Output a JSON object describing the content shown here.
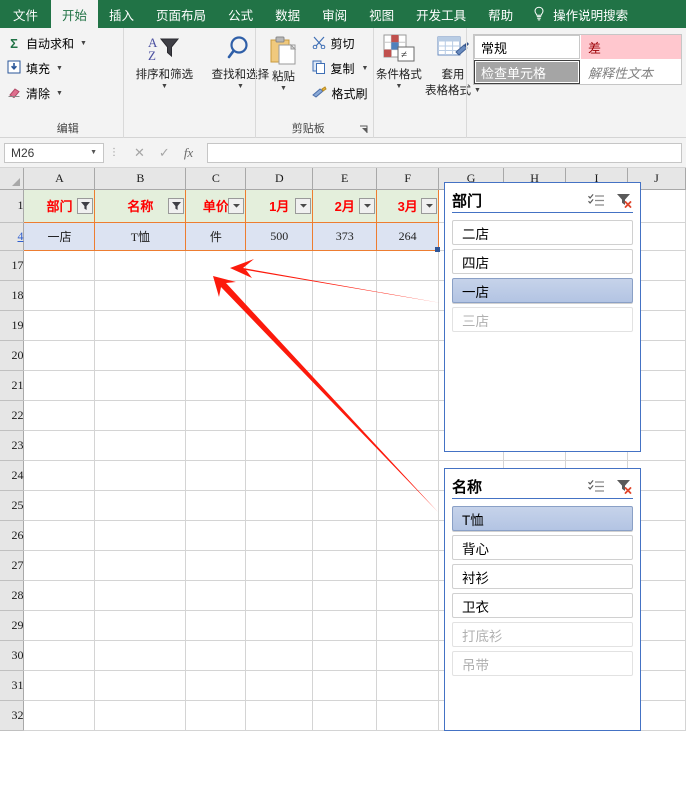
{
  "ribbon": {
    "tabs": [
      {
        "label": "文件",
        "active": false,
        "file": true
      },
      {
        "label": "开始",
        "active": true
      },
      {
        "label": "插入",
        "active": false
      },
      {
        "label": "页面布局",
        "active": false
      },
      {
        "label": "公式",
        "active": false
      },
      {
        "label": "数据",
        "active": false
      },
      {
        "label": "审阅",
        "active": false
      },
      {
        "label": "视图",
        "active": false
      },
      {
        "label": "开发工具",
        "active": false
      },
      {
        "label": "帮助",
        "active": false
      }
    ],
    "tellme": "操作说明搜索",
    "bulb_icon": "lightbulb-icon",
    "groups": {
      "editing": {
        "label": "编辑",
        "autosum": "自动求和",
        "fill": "填充",
        "clear": "清除",
        "sort_filter": "排序和筛选",
        "find_select": "查找和选择"
      },
      "clipboard": {
        "label": "剪贴板",
        "paste": "粘贴",
        "cut": "剪切",
        "copy": "复制",
        "format_painter": "格式刷",
        "dialog_launcher": "⌐"
      },
      "styles": {
        "conditional_format": "条件格式",
        "table_format_line1": "套用",
        "table_format_line2": "表格格式"
      },
      "cell_styles": {
        "normal": "常规",
        "bad": "差",
        "check_cell": "检查单元格",
        "explanatory": "解释性文本"
      }
    }
  },
  "formula_bar": {
    "name_box": "M26",
    "cancel_icon": "✕",
    "enter_icon": "✓",
    "fx_icon": "fx",
    "formula_value": "",
    "formula_placeholder": ""
  },
  "sheet": {
    "columns": [
      "A",
      "B",
      "C",
      "D",
      "E",
      "F",
      "G",
      "H",
      "I",
      "J"
    ],
    "row_headers": [
      "1",
      "4",
      "17",
      "18",
      "19",
      "20",
      "21",
      "22",
      "23",
      "24",
      "25",
      "26",
      "27",
      "28",
      "29",
      "30",
      "31",
      "32"
    ],
    "filtered_row": "4",
    "header_row": {
      "row_number": "1",
      "cells": [
        {
          "text": "部门",
          "filter": "active"
        },
        {
          "text": "名称",
          "filter": "active"
        },
        {
          "text": "单价",
          "filter": "plain"
        },
        {
          "text": "1月",
          "filter": "plain"
        },
        {
          "text": "2月",
          "filter": "plain"
        },
        {
          "text": "3月",
          "filter": "plain"
        }
      ]
    },
    "data_row": {
      "row_number": "4",
      "cells": [
        "一店",
        "T恤",
        "件",
        "500",
        "373",
        "264"
      ]
    }
  },
  "slicers": [
    {
      "title": "部门",
      "multiselect_icon": "multi-select-icon",
      "clearfilter_icon": "clear-filter-icon",
      "items": [
        {
          "label": "二店",
          "state": "normal"
        },
        {
          "label": "四店",
          "state": "normal"
        },
        {
          "label": "一店",
          "state": "selected"
        },
        {
          "label": "三店",
          "state": "disabled"
        }
      ]
    },
    {
      "title": "名称",
      "multiselect_icon": "multi-select-icon",
      "clearfilter_icon": "clear-filter-icon",
      "items": [
        {
          "label": "T恤",
          "state": "selected"
        },
        {
          "label": "背心",
          "state": "normal"
        },
        {
          "label": "衬衫",
          "state": "normal"
        },
        {
          "label": "卫衣",
          "state": "normal"
        },
        {
          "label": "打底衫",
          "state": "disabled"
        },
        {
          "label": "吊带",
          "state": "disabled"
        }
      ]
    }
  ],
  "annotations": {
    "arrow_color": "#fc1a0c",
    "arrow_count": 2
  },
  "colors": {
    "ribbon_green": "#217346",
    "header_fill": "#e4efdc",
    "header_text": "#ff0000",
    "table_border": "#ed7d31",
    "data_fill": "#dce3f2",
    "slicer_border": "#4472c4",
    "slicer_selected": "#b3c4e3"
  }
}
